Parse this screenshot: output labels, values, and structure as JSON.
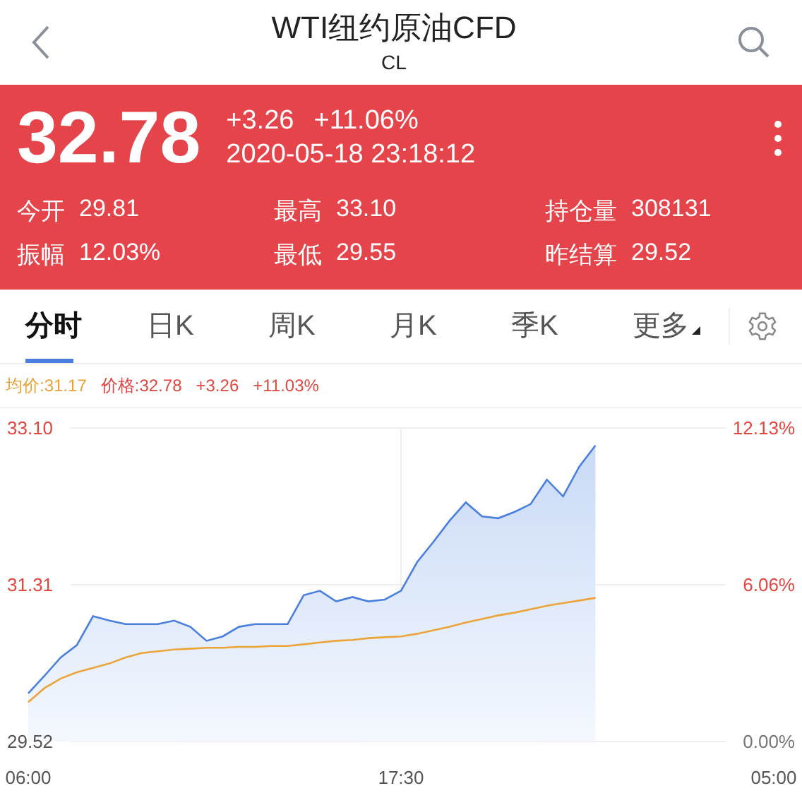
{
  "header": {
    "title": "WTI纽约原油CFD",
    "subtitle": "CL"
  },
  "quote": {
    "price": "32.78",
    "change": "+3.26",
    "change_pct": "+11.06%",
    "time": "2020-05-18 23:18:12",
    "stats": [
      {
        "label": "今开",
        "value": "29.81"
      },
      {
        "label": "最高",
        "value": "33.10"
      },
      {
        "label": "持仓量",
        "value": "308131"
      },
      {
        "label": "振幅",
        "value": "12.03%"
      },
      {
        "label": "最低",
        "value": "29.55"
      },
      {
        "label": "昨结算",
        "value": "29.52"
      }
    ]
  },
  "tabs": [
    {
      "label": "分时",
      "selected": true,
      "kind": "plain"
    },
    {
      "label": "日K",
      "selected": false,
      "kind": "plain"
    },
    {
      "label": "周K",
      "selected": false,
      "kind": "plain"
    },
    {
      "label": "月K",
      "selected": false,
      "kind": "plain"
    },
    {
      "label": "季K",
      "selected": false,
      "kind": "plain"
    },
    {
      "label": "更多",
      "selected": false,
      "kind": "dropdown"
    }
  ],
  "chart": {
    "legend": [
      {
        "value": ":31.17",
        "kind": "avg"
      },
      {
        "value": ":32.78",
        "kind": "price"
      },
      {
        "value": "+3.26",
        "kind": "change"
      },
      {
        "value": "+11.03%",
        "kind": "change"
      }
    ],
    "right_axis_labels": [
      {
        "text": "12.13%",
        "kind": "up"
      },
      {
        "text": "6.06%",
        "kind": "up"
      },
      {
        "text": "0.00%",
        "kind": "flat"
      }
    ],
    "chart_data": {
      "type": "area",
      "categories": [
        "06:00",
        null,
        null,
        null,
        null,
        null,
        null,
        null,
        null,
        null,
        null,
        null,
        null,
        null,
        null,
        null,
        null,
        null,
        null,
        null,
        null,
        null,
        null,
        "17:30",
        null,
        null,
        null,
        null,
        null,
        null,
        null,
        null,
        null,
        null,
        null,
        null,
        null,
        null,
        null,
        null,
        null,
        null,
        null,
        null,
        null,
        null,
        "05:00"
      ],
      "ylim": [
        29.52,
        33.1
      ],
      "yticks": [
        {
          "value": 33.1,
          "label": "33.10"
        },
        {
          "value": 31.31,
          "label": "31.31"
        },
        {
          "value": 29.52,
          "label": "29.52"
        }
      ],
      "series": [
        {
          "name": "价格",
          "type": "area",
          "color": "#4a7fe0",
          "values": [
            30.07,
            30.27,
            30.48,
            30.62,
            30.95,
            30.9,
            30.86,
            30.86,
            30.86,
            30.9,
            30.83,
            30.67,
            30.72,
            30.83,
            30.86,
            30.86,
            30.86,
            31.19,
            31.24,
            31.12,
            31.17,
            31.12,
            31.14,
            31.24,
            31.57,
            31.8,
            32.04,
            32.25,
            32.09,
            32.07,
            32.14,
            32.23,
            32.51,
            32.32,
            32.66,
            32.9,
            null,
            null,
            null,
            null,
            null,
            null,
            null,
            null,
            null,
            null,
            null
          ]
        },
        {
          "name": "均价",
          "type": "line",
          "color": "#eba43a",
          "values": [
            29.97,
            30.13,
            30.24,
            30.31,
            30.36,
            30.41,
            30.48,
            30.53,
            30.55,
            30.57,
            30.58,
            30.59,
            30.59,
            30.6,
            30.6,
            30.61,
            30.61,
            30.63,
            30.65,
            30.67,
            30.68,
            30.7,
            30.71,
            30.72,
            30.75,
            30.79,
            30.83,
            30.88,
            30.92,
            30.96,
            30.99,
            31.03,
            31.07,
            31.1,
            31.13,
            31.16,
            null,
            null,
            null,
            null,
            null,
            null,
            null,
            null,
            null,
            null,
            null
          ]
        }
      ]
    }
  }
}
